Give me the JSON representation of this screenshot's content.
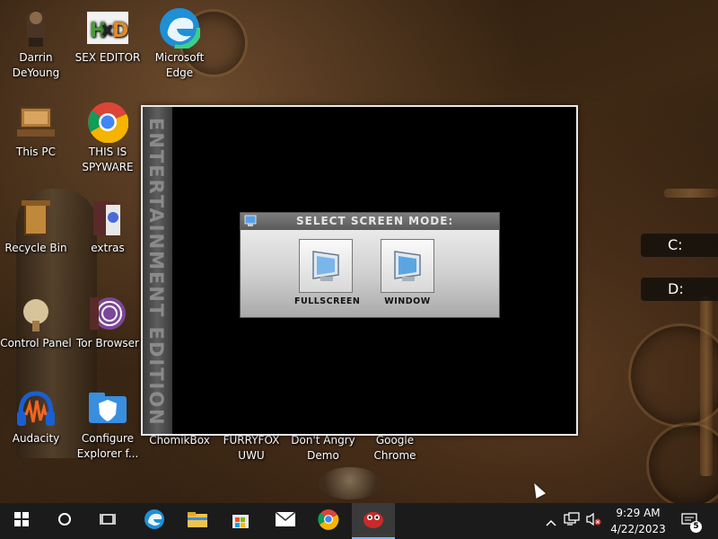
{
  "desktop_icons": [
    {
      "label": "Darrin DeYoung",
      "icon": "user-figure-icon"
    },
    {
      "label": "SEX EDITOR",
      "icon": "hxd-editor-icon"
    },
    {
      "label": "Microsoft Edge",
      "icon": "edge-icon"
    },
    {
      "label": "This PC",
      "icon": "computer-icon"
    },
    {
      "label": "THIS IS SPYWARE",
      "icon": "chrome-icon"
    },
    {
      "label": "Recycle Bin",
      "icon": "recycle-bin-icon"
    },
    {
      "label": "extras",
      "icon": "folder-icon"
    },
    {
      "label": "Control Panel",
      "icon": "control-panel-icon"
    },
    {
      "label": "Tor Browser",
      "icon": "tor-icon"
    },
    {
      "label": "Audacity",
      "icon": "audacity-icon"
    },
    {
      "label": "Configure Explorer f...",
      "icon": "shield-folder-icon"
    },
    {
      "label": "ChomikBox",
      "icon": "app-icon"
    },
    {
      "label": "FURRYFOX UWU",
      "icon": "app-icon"
    },
    {
      "label": "Don't Angry Demo",
      "icon": "app-icon"
    },
    {
      "label": "Google Chrome",
      "icon": "chrome-icon"
    }
  ],
  "drives": [
    "C:",
    "D:"
  ],
  "app": {
    "sidebar_text": "ENTERTAINMENT EDITION",
    "dialog_title": "SELECT SCREEN MODE:",
    "fullscreen_label": "FULLSCREEN",
    "window_label": "WINDOW"
  },
  "taskbar": {
    "time": "9:29 AM",
    "date": "4/22/2023",
    "notification_count": "5"
  },
  "colors": {
    "taskbar": "#1b1b1b",
    "accent": "#7fb6f0"
  }
}
